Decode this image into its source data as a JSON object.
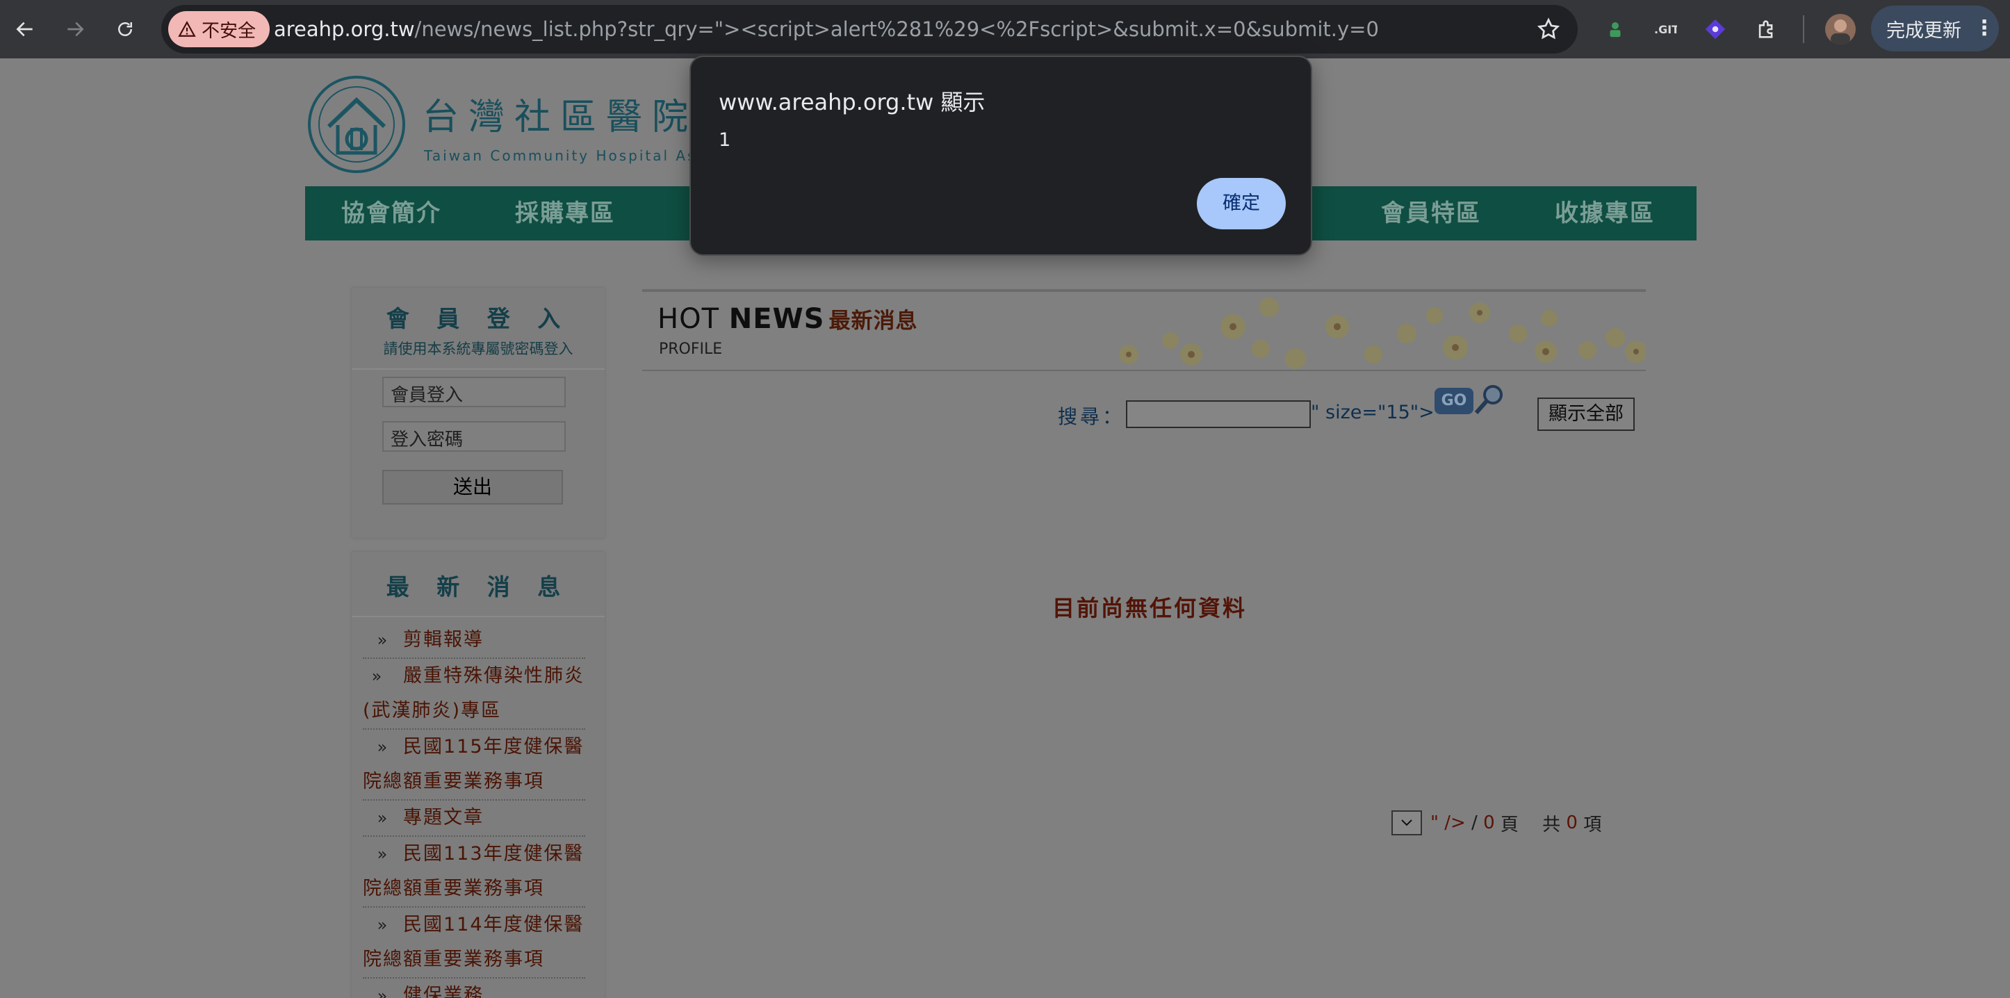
{
  "browser": {
    "insecure_label": "不安全",
    "url_host": "areahp.org.tw",
    "url_path": "/news/news_list.php?str_qry=\"><script>alert%281%29<%2Fscript>&submit.x=0&submit.y=0",
    "update_label": "完成更新"
  },
  "site": {
    "logo_title": "台灣社區醫院協",
    "logo_en": "Taiwan Community Hospital Asso",
    "nav": [
      "協會簡介",
      "採購專區",
      "會員特區",
      "收據專區"
    ],
    "login": {
      "title": "會 員 登 入",
      "subtitle": "請使用本系統專屬號密碼登入",
      "username_placeholder": "會員登入",
      "password_placeholder": "登入密碼",
      "submit_label": "送出"
    },
    "news_panel": {
      "title": "最 新 消 息",
      "items": [
        "剪輯報導",
        "嚴重特殊傳染性肺炎(武漢肺炎)專區",
        "民國115年度健保醫院總額重要業務事項",
        "專題文章",
        "民國113年度健保醫院總額重要業務事項",
        "民國114年度健保醫院總額重要業務事項",
        "健保業務"
      ]
    },
    "hot_news": {
      "hot": "HOT",
      "news": "NEWS",
      "zh": "最新消息",
      "profile": "PROFILE"
    },
    "search": {
      "label": "搜尋：",
      "value": "",
      "stray_text": "\" size=\"15\">",
      "go_label": "GO",
      "show_all_label": "顯示全部"
    },
    "empty_message": "目前尚無任何資料",
    "pagination": {
      "artifact": "\" />",
      "slash": " / ",
      "pages": "0",
      "page_unit": " 頁　 共 ",
      "count": "0",
      "item_unit": " 項"
    }
  },
  "dialog": {
    "title": "www.areahp.org.tw 顯示",
    "message": "1",
    "ok_label": "確定"
  },
  "colors": {
    "overlay": "#808080",
    "nav_bg": "#0f4e42",
    "dialog_bg": "#202124",
    "dialog_button": "#a8c7fa"
  }
}
